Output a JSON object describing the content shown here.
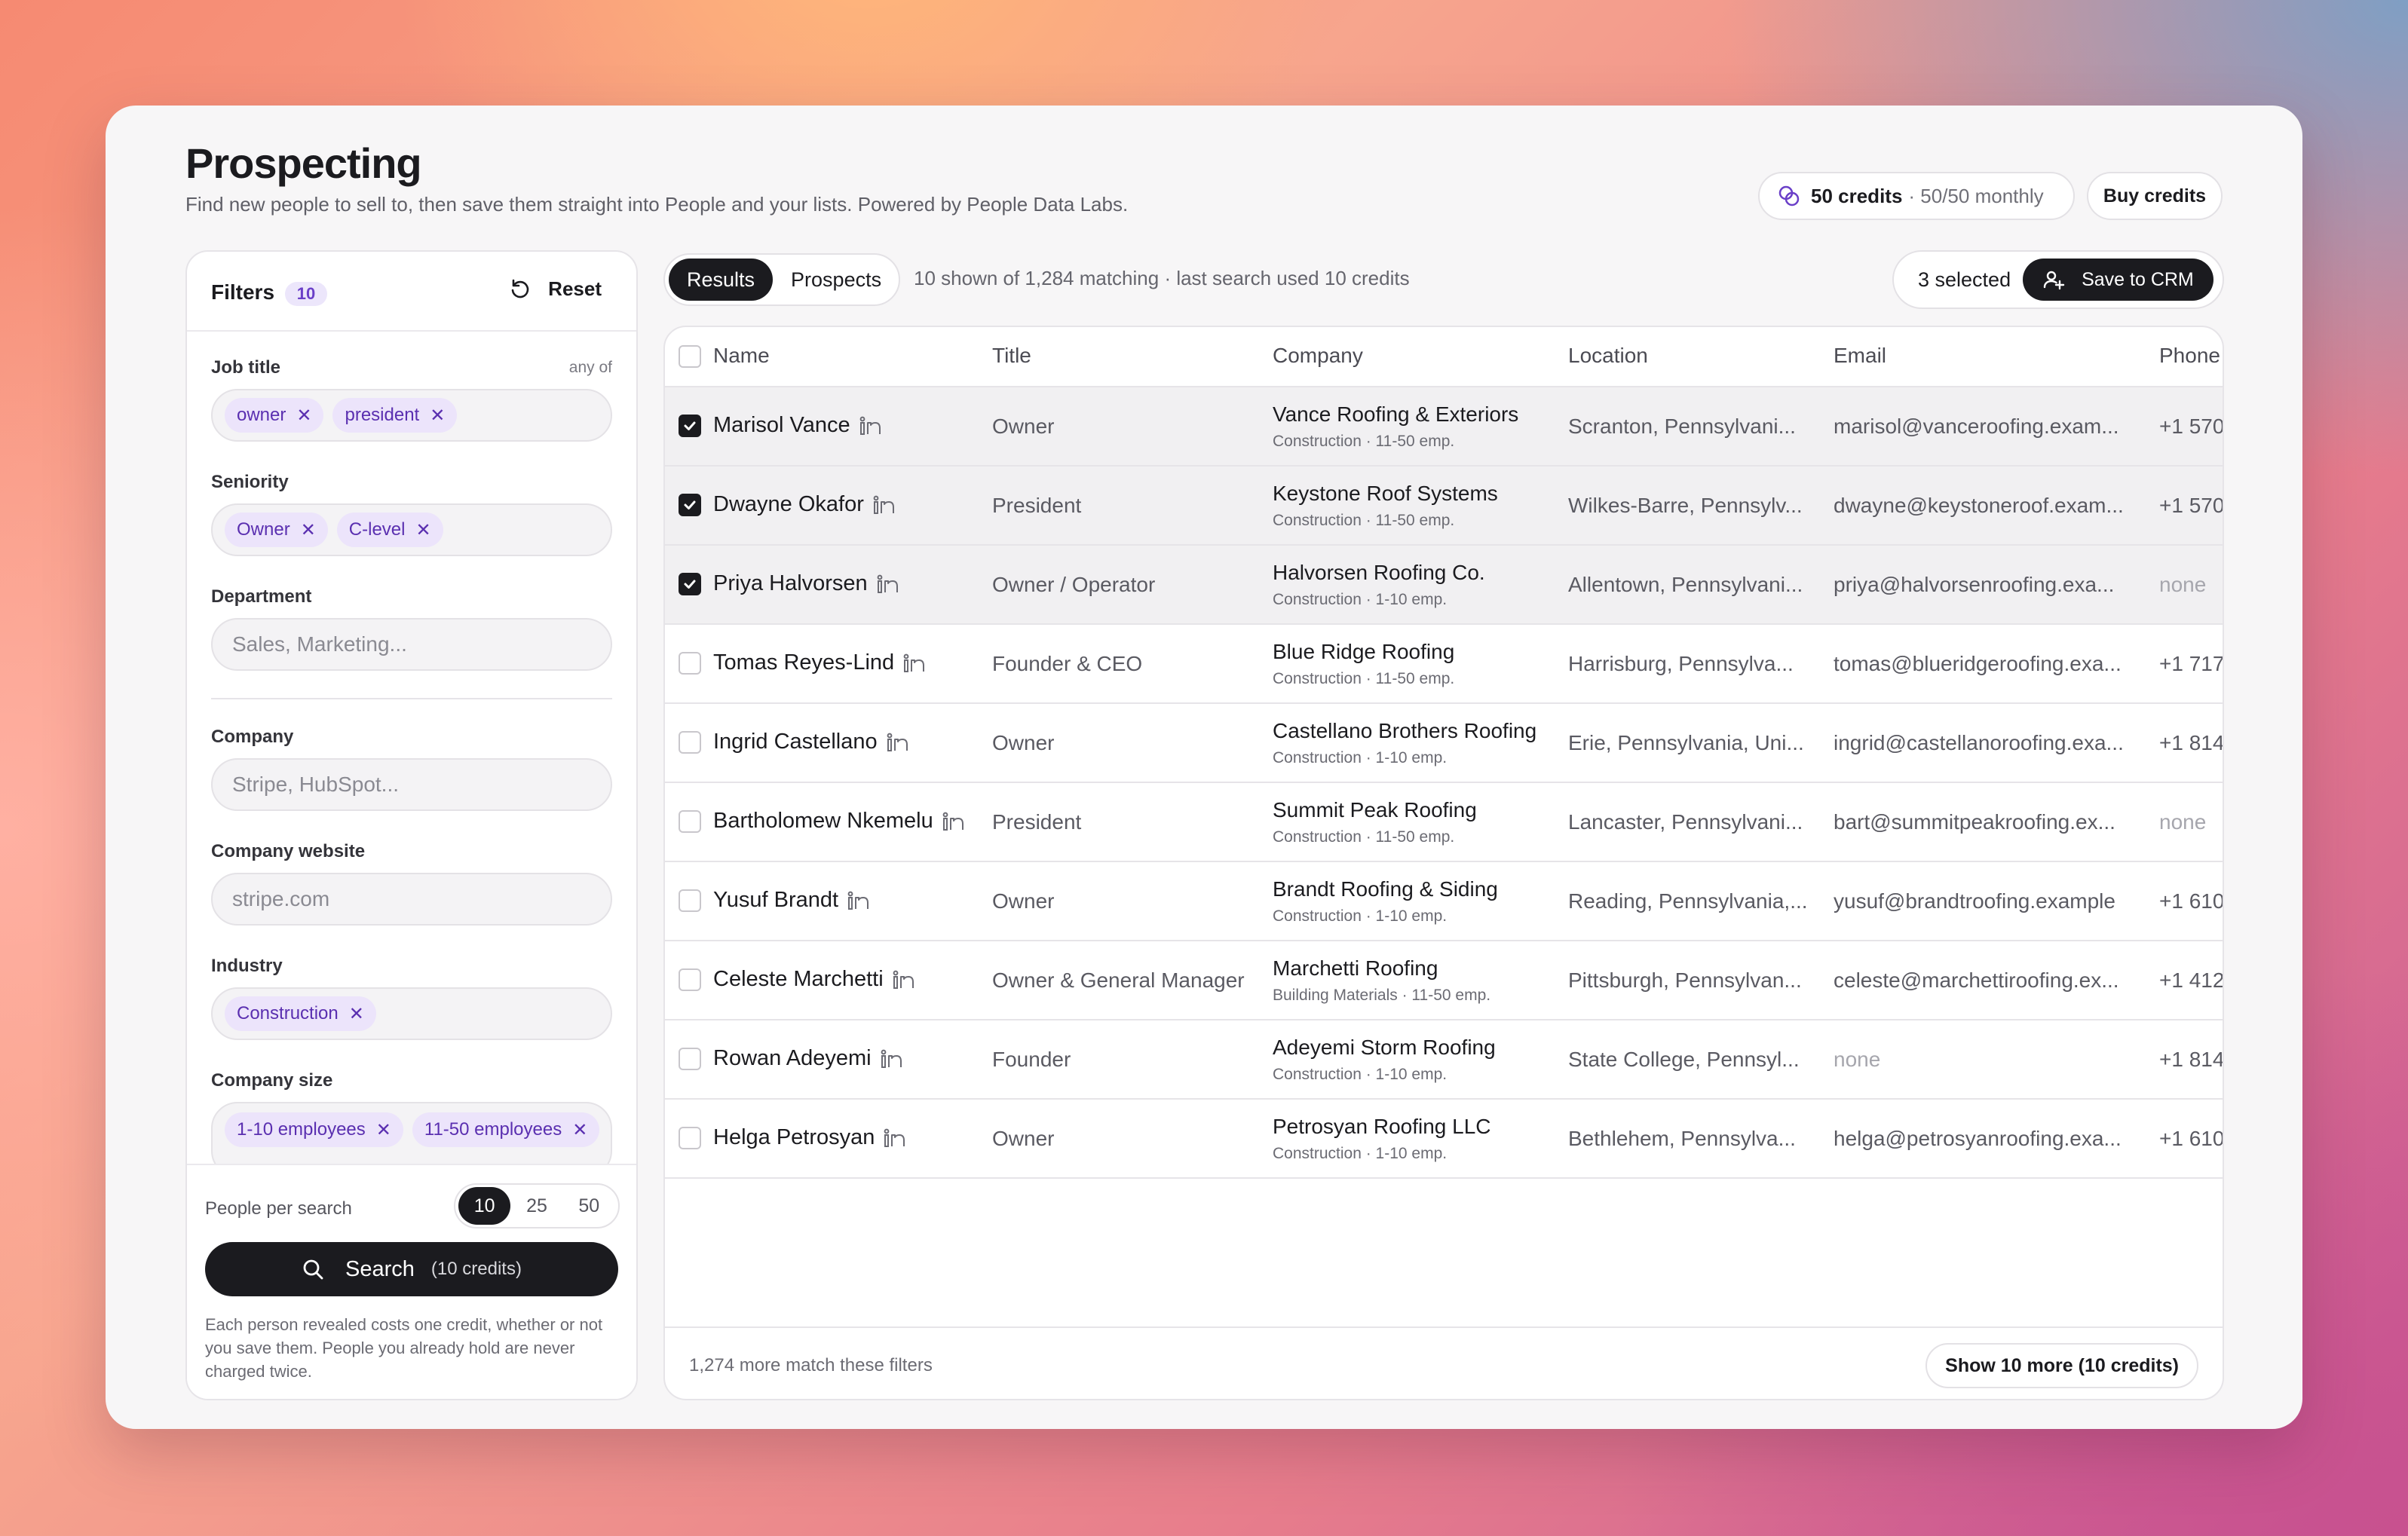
{
  "page": {
    "title": "Prospecting",
    "subtitle": "Find new people to sell to, then save them straight into People and your lists. Powered by People Data Labs."
  },
  "credits": {
    "amount": "50 credits",
    "monthly": "· 50/50 monthly",
    "buy_label": "Buy credits"
  },
  "filters": {
    "title": "Filters",
    "count": "10",
    "reset_label": "Reset",
    "job_title": {
      "label": "Job title",
      "hint": "any of",
      "chips": [
        "owner",
        "president"
      ]
    },
    "seniority": {
      "label": "Seniority",
      "chips": [
        "Owner",
        "C-level"
      ]
    },
    "department": {
      "label": "Department",
      "placeholder": "Sales, Marketing..."
    },
    "company": {
      "label": "Company",
      "placeholder": "Stripe, HubSpot..."
    },
    "company_website": {
      "label": "Company website",
      "placeholder": "stripe.com"
    },
    "industry": {
      "label": "Industry",
      "chips": [
        "Construction"
      ]
    },
    "company_size": {
      "label": "Company size",
      "chips": [
        "1-10 employees",
        "11-50 employees"
      ]
    },
    "people_per_search": {
      "label": "People per search",
      "options": [
        "10",
        "25",
        "50"
      ],
      "selected": "10"
    },
    "search_label": "Search",
    "search_cost": "(10 credits)",
    "note": "Each person revealed costs one credit, whether or not you save them. People you already hold are never charged twice."
  },
  "results": {
    "tabs": [
      "Results",
      "Prospects"
    ],
    "active_tab": "Results",
    "meta": "10 shown of 1,284 matching · last search used 10 credits",
    "selected_label": "3 selected",
    "save_label": "Save to CRM",
    "columns": [
      "Name",
      "Title",
      "Company",
      "Location",
      "Email",
      "Phone"
    ],
    "rows": [
      {
        "checked": true,
        "name": "Marisol Vance",
        "title": "Owner",
        "company": "Vance Roofing & Exteriors",
        "company_sub": "Construction · 11-50 emp.",
        "location": "Scranton, Pennsylvani...",
        "email": "marisol@vanceroofing.exam...",
        "phone": "+1 570"
      },
      {
        "checked": true,
        "name": "Dwayne Okafor",
        "title": "President",
        "company": "Keystone Roof Systems",
        "company_sub": "Construction · 11-50 emp.",
        "location": "Wilkes-Barre, Pennsylv...",
        "email": "dwayne@keystoneroof.exam...",
        "phone": "+1 570"
      },
      {
        "checked": true,
        "name": "Priya Halvorsen",
        "title": "Owner / Operator",
        "company": "Halvorsen Roofing Co.",
        "company_sub": "Construction · 1-10 emp.",
        "location": "Allentown, Pennsylvani...",
        "email": "priya@halvorsenroofing.exa...",
        "phone": "none"
      },
      {
        "checked": false,
        "name": "Tomas Reyes-Lind",
        "title": "Founder & CEO",
        "company": "Blue Ridge Roofing",
        "company_sub": "Construction · 11-50 emp.",
        "location": "Harrisburg, Pennsylva...",
        "email": "tomas@blueridgeroofing.exa...",
        "phone": "+1 717"
      },
      {
        "checked": false,
        "name": "Ingrid Castellano",
        "title": "Owner",
        "company": "Castellano Brothers Roofing",
        "company_sub": "Construction · 1-10 emp.",
        "location": "Erie, Pennsylvania, Uni...",
        "email": "ingrid@castellanoroofing.exa...",
        "phone": "+1 814"
      },
      {
        "checked": false,
        "name": "Bartholomew Nkemelu",
        "title": "President",
        "company": "Summit Peak Roofing",
        "company_sub": "Construction · 11-50 emp.",
        "location": "Lancaster, Pennsylvani...",
        "email": "bart@summitpeakroofing.ex...",
        "phone": "none"
      },
      {
        "checked": false,
        "name": "Yusuf Brandt",
        "title": "Owner",
        "company": "Brandt Roofing & Siding",
        "company_sub": "Construction · 1-10 emp.",
        "location": "Reading, Pennsylvania,...",
        "email": "yusuf@brandtroofing.example",
        "phone": "+1 610"
      },
      {
        "checked": false,
        "name": "Celeste Marchetti",
        "title": "Owner & General Manager",
        "company": "Marchetti Roofing",
        "company_sub": "Building Materials · 11-50 emp.",
        "location": "Pittsburgh, Pennsylvan...",
        "email": "celeste@marchettiroofing.ex...",
        "phone": "+1 412"
      },
      {
        "checked": false,
        "name": "Rowan Adeyemi",
        "title": "Founder",
        "company": "Adeyemi Storm Roofing",
        "company_sub": "Construction · 1-10 emp.",
        "location": "State College, Pennsyl...",
        "email": "none",
        "phone": "+1 814"
      },
      {
        "checked": false,
        "name": "Helga Petrosyan",
        "title": "Owner",
        "company": "Petrosyan Roofing LLC",
        "company_sub": "Construction · 1-10 emp.",
        "location": "Bethlehem, Pennsylva...",
        "email": "helga@petrosyanroofing.exa...",
        "phone": "+1 610"
      }
    ],
    "footer_text": "1,274 more match these filters",
    "show_more_label": "Show 10 more (10 credits)"
  }
}
